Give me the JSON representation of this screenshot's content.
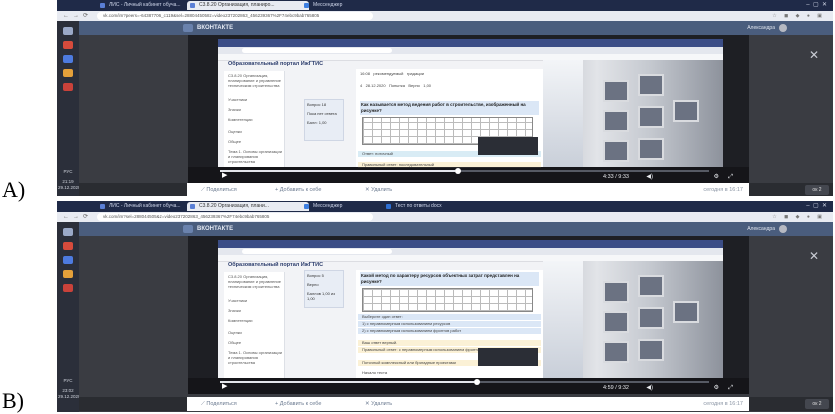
{
  "panels": [
    {
      "letter": "A)",
      "browser": {
        "tabs": [
          "ЛИС - Личный кабинет обуча...",
          "С3.8.20 Организация, планиро...",
          "Мессенджер"
        ],
        "url": "vk.com/im?peers=-64387706_c119&sel=2880445058z=video237202863_456239367%2F74ebc9bab765805"
      },
      "vk": {
        "title": "ВКОНТАКТЕ",
        "user": "Александра"
      },
      "portal": {
        "title": "Образовательный портал ИжГТИС",
        "sidebar": [
          "С3.8.20 Организация, планирование и управление техническим строительства",
          "Участники",
          "Значки",
          "Компетенции",
          "Оценки",
          "Общее",
          "Тема 1. Основы организации и планирования строительства"
        ],
        "question_card": [
          "Вопрос 18",
          "Пока нет ответа",
          "Балл: 1,00"
        ],
        "table_rows": [
          [
            "16:08",
            "рекомендуемый",
            "градации"
          ],
          [
            "4",
            "28.12.2020",
            "Попытка",
            "Верно",
            "1,00"
          ]
        ],
        "question": "Как называется метод ведения работ в строительстве, изображенный на рисунке?",
        "answer_boxes": [
          "Ответ: поточный",
          "Правильный ответ: последовательный"
        ]
      },
      "player": {
        "time": "4:33 / 9:33"
      },
      "taskbar": {
        "lang": "РУС",
        "clock": "21:19",
        "date": "29.12.2020"
      },
      "footer": {
        "actions": [
          "Поделиться",
          "Добавить к себе",
          "Удалить"
        ],
        "date": "сегодня в 16:17",
        "button": "ок 2"
      }
    },
    {
      "letter": "B)",
      "browser": {
        "tabs": [
          "ЛИС - Личный кабинет обуча...",
          "С3.8.20 Организация, плани...",
          "Мессенджер",
          "Тест по ответы docx"
        ],
        "url": "vk.com/im?sel=288044505&z=video237202863_456239367%2F74ebc9bab765805"
      },
      "vk": {
        "title": "ВКОНТАКТЕ",
        "user": "Александра"
      },
      "portal": {
        "title": "Образовательный портал ИжГТИС",
        "sidebar": [
          "С3.8.20 Организация, планирование и управление техническим строительства",
          "Участники",
          "Значки",
          "Компетенции",
          "Оценки",
          "Общее",
          "Тема 1. Основы организации и планирования строительства"
        ],
        "question_card": [
          "Вопрос 5",
          "Верно",
          "Баллов 1,00 из 1,00"
        ],
        "table_rows": [],
        "question": "Какой метод по характеру ресурсов объектных затрат представлен на рисунке?",
        "answer_boxes": [
          "Выберите один ответ:",
          "1) с неравномерным использованием ресурсов",
          "2) с неравномерным использованием фронтов работ",
          "Ваш ответ верный.",
          "Правильный ответ: с неравномерным использованием фронтов работ",
          "Поточный комплексный или бригадные проектами"
        ],
        "footer_text": "Начало теста"
      },
      "player": {
        "time": "4:59 / 9:32"
      },
      "taskbar": {
        "lang": "РУС",
        "clock": "23:02",
        "date": "29.12.2020"
      },
      "footer": {
        "actions": [
          "Поделиться",
          "Добавить к себе",
          "Удалить"
        ],
        "date": "сегодня в 16:17",
        "button": "ок 2"
      }
    }
  ]
}
